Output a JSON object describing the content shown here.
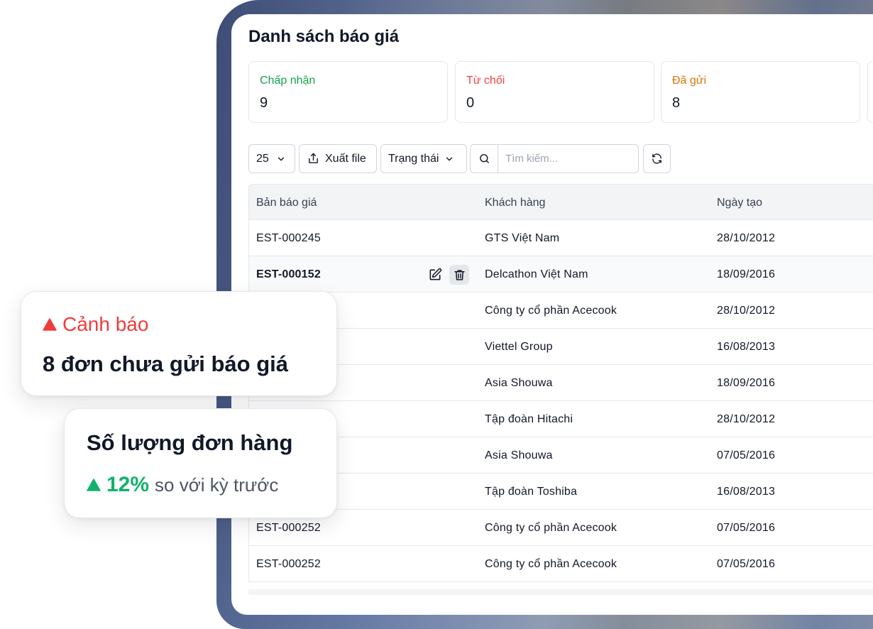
{
  "page": {
    "title": "Danh sách báo giá"
  },
  "stats": [
    {
      "label": "Chấp nhận",
      "value": "9",
      "color": "#16a34a"
    },
    {
      "label": "Từ chối",
      "value": "0",
      "color": "#ef4444"
    },
    {
      "label": "Đã gửi",
      "value": "8",
      "color": "#d97706"
    }
  ],
  "toolbar": {
    "page_size": "25",
    "export_label": "Xuất file",
    "status_label": "Trạng thái",
    "search_placeholder": "Tìm kiếm..."
  },
  "table": {
    "columns": [
      "Bản báo giá",
      "Khách hàng",
      "Ngày tạo"
    ],
    "rows": [
      {
        "code": "EST-000245",
        "customer": "GTS Việt Nam",
        "date": "28/10/2012"
      },
      {
        "code": "EST-000152",
        "customer": "Delcathon Việt Nam",
        "date": "18/09/2016"
      },
      {
        "code": "",
        "customer": "Công ty cổ phần Acecook",
        "date": "28/10/2012"
      },
      {
        "code": "",
        "customer": "Viettel Group",
        "date": "16/08/2013"
      },
      {
        "code": "",
        "customer": "Asia Shouwa",
        "date": "18/09/2016"
      },
      {
        "code": "",
        "customer": "Tập đoàn Hitachi",
        "date": "28/10/2012"
      },
      {
        "code": "",
        "customer": "Asia Shouwa",
        "date": "07/05/2016"
      },
      {
        "code": "",
        "customer": "Tập đoàn Toshiba",
        "date": "16/08/2013"
      },
      {
        "code": "EST-000252",
        "customer": "Công ty cổ phần Acecook",
        "date": "07/05/2016"
      },
      {
        "code": "EST-000252",
        "customer": "Công ty cổ phần Acecook",
        "date": "07/05/2016"
      }
    ]
  },
  "warning_card": {
    "title": "Cảnh báo",
    "message": "8 đơn chưa gửi báo giá",
    "color": "#ef3b3b"
  },
  "orders_card": {
    "title": "Số lượng đơn hàng",
    "percent": "12%",
    "comparison": "so với kỳ trước",
    "color": "#10b26c"
  }
}
